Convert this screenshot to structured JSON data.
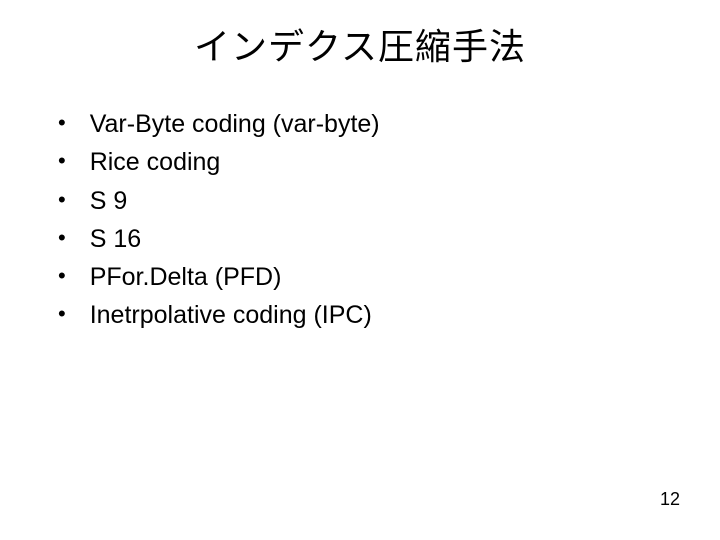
{
  "title": "インデクス圧縮手法",
  "bullets": [
    "Var-Byte coding (var-byte)",
    "Rice coding",
    "S 9",
    "S 16",
    "PFor.Delta (PFD)",
    "Inetrpolative coding (IPC)"
  ],
  "pageNumber": "12"
}
